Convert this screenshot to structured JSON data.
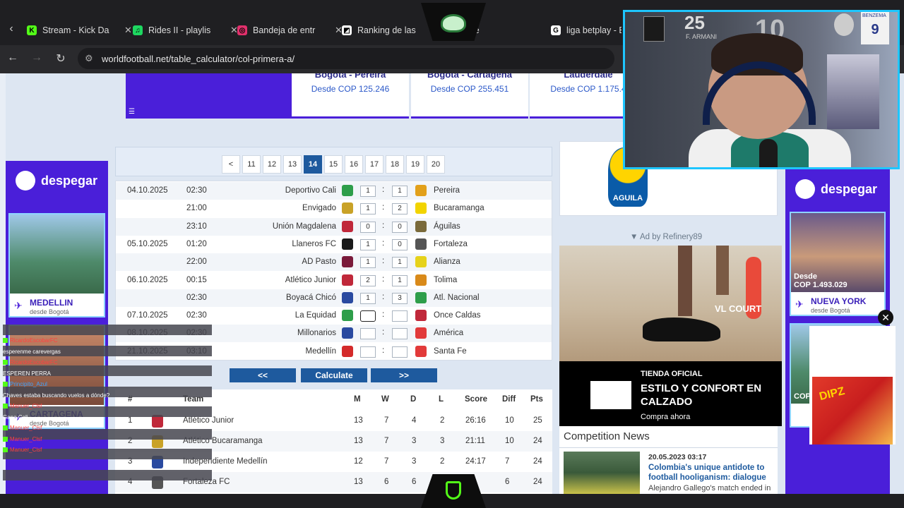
{
  "tabs": [
    {
      "label": "Stream - Kick Da",
      "favicon": "K",
      "favicon_color": "#53fc18"
    },
    {
      "label": "Rides II - playlis",
      "favicon": "♫",
      "favicon_color": "#1ed760"
    },
    {
      "label": "Bandeja de entr",
      "favicon": "◎",
      "favicon_color": "#e1306c"
    },
    {
      "label": "Ranking de las",
      "favicon": "◩",
      "favicon_color": "#ffffff"
    },
    {
      "label": "gle",
      "favicon": "",
      "favicon_color": "#1f1f22"
    },
    {
      "label": "liga betplay - B",
      "favicon": "G",
      "favicon_color": "#ffffff"
    }
  ],
  "url": "worldfootball.net/table_calculator/col-primera-a/",
  "flights": [
    {
      "route": "Bogotá - Pereira",
      "price": "Desde COP 125.246"
    },
    {
      "route": "Bogotá - Cartagena",
      "price": "Desde COP 255.451"
    },
    {
      "route": "Lauderdale",
      "price": "Desde COP 1.175.4"
    }
  ],
  "pagination": {
    "prev": "<",
    "pages": [
      "11",
      "12",
      "13",
      "14",
      "15",
      "16",
      "17",
      "18",
      "19",
      "20"
    ],
    "active": "14"
  },
  "fixtures": [
    {
      "date": "04.10.2025",
      "time": "02:30",
      "home": "Deportivo Cali",
      "home_goals": "1",
      "away_goals": "1",
      "away": "Pereira",
      "home_color": "#2e9e4a",
      "away_color": "#e2a01a"
    },
    {
      "date": "",
      "time": "21:00",
      "home": "Envigado",
      "home_goals": "1",
      "away_goals": "2",
      "away": "Bucaramanga",
      "home_color": "#c9a227",
      "away_color": "#f2d400"
    },
    {
      "date": "",
      "time": "23:10",
      "home": "Unión Magdalena",
      "home_goals": "0",
      "away_goals": "0",
      "away": "Águilas",
      "home_color": "#c0283a",
      "away_color": "#7a6a3a"
    },
    {
      "date": "05.10.2025",
      "time": "01:20",
      "home": "Llaneros FC",
      "home_goals": "1",
      "away_goals": "0",
      "away": "Fortaleza",
      "home_color": "#1a1a1a",
      "away_color": "#555555"
    },
    {
      "date": "",
      "time": "22:00",
      "home": "AD Pasto",
      "home_goals": "1",
      "away_goals": "1",
      "away": "Alianza",
      "home_color": "#7a1a3a",
      "away_color": "#e6d21a"
    },
    {
      "date": "06.10.2025",
      "time": "00:15",
      "home": "Atlético Junior",
      "home_goals": "2",
      "away_goals": "1",
      "away": "Tolima",
      "home_color": "#c0283a",
      "away_color": "#d98a1a"
    },
    {
      "date": "",
      "time": "02:30",
      "home": "Boyacá Chicó",
      "home_goals": "1",
      "away_goals": "3",
      "away": "Atl. Nacional",
      "home_color": "#2a4aa0",
      "away_color": "#2e9e4a"
    },
    {
      "date": "07.10.2025",
      "time": "02:30",
      "home": "La Equidad",
      "home_goals": "",
      "away_goals": "",
      "away": "Once Caldas",
      "home_color": "#2e9e4a",
      "away_color": "#c0283a"
    },
    {
      "date": "08.10.2025",
      "time": "02:30",
      "home": "Millonarios",
      "home_goals": "",
      "away_goals": "",
      "away": "América",
      "home_color": "#2a4aa0",
      "away_color": "#e23a3a"
    },
    {
      "date": "21.10.2025",
      "time": "03:10",
      "home": "Medellín",
      "home_goals": "",
      "away_goals": "",
      "away": "Santa Fe",
      "home_color": "#d42a2a",
      "away_color": "#e23a3a"
    }
  ],
  "calc_buttons": {
    "back": "<<",
    "calculate": "Calculate",
    "forward": ">>"
  },
  "standings": {
    "headers": {
      "pos": "#",
      "team": "Team",
      "m": "M",
      "w": "W",
      "d": "D",
      "l": "L",
      "score": "Score",
      "diff": "Diff",
      "pts": "Pts"
    },
    "rows": [
      {
        "pos": "1",
        "team": "Atlético Junior",
        "m": "13",
        "w": "7",
        "d": "4",
        "l": "2",
        "score": "26:16",
        "diff": "10",
        "pts": "25",
        "color": "#c0283a"
      },
      {
        "pos": "2",
        "team": "Atlético Bucaramanga",
        "m": "13",
        "w": "7",
        "d": "3",
        "l": "3",
        "score": "21:11",
        "diff": "10",
        "pts": "24",
        "color": "#c9a227"
      },
      {
        "pos": "3",
        "team": "Independiente Medellín",
        "m": "12",
        "w": "7",
        "d": "3",
        "l": "2",
        "score": "24:17",
        "diff": "7",
        "pts": "24",
        "color": "#2a4aa0"
      },
      {
        "pos": "4",
        "team": "Fortaleza FC",
        "m": "13",
        "w": "6",
        "d": "6",
        "l": "",
        "score": "",
        "diff": "6",
        "pts": "24",
        "color": "#555555"
      }
    ]
  },
  "side_ads": {
    "brand": "despegar",
    "left": {
      "destination": "MEDELLIN",
      "from": "desde Bogotá",
      "second_destination": "CARTAGENA",
      "second_from": "desde Bogotá"
    },
    "right": {
      "destination": "NUEVA YORK",
      "from": "desde Bogotá",
      "price_label": "Desde",
      "price": "COP 1.493.029",
      "second_price_label": "COP"
    }
  },
  "cup": {
    "label": "AGUILA"
  },
  "ad_note": "▼ Ad by Refinery89",
  "adidas_ad": {
    "slogan": "VL COURT",
    "store": "TIENDA OFICIAL",
    "headline": "ESTILO Y CONFORT EN CALZADO",
    "cta": "Compra ahora"
  },
  "news": {
    "title": "Competition News",
    "date": "20.05.2023 03:17",
    "headline": "Colombia's unique antidote to football hooliganism: dialogue",
    "teaser": "Alejandro Gallego's match ended in"
  },
  "chat": [
    {
      "user": "RicardoEscobarFC",
      "msg": "",
      "red": true
    },
    {
      "user": "",
      "msg": "esperenme carevergas",
      "red": false
    },
    {
      "user": "RicardoEscobarFC",
      "msg": "",
      "red": true
    },
    {
      "user": "",
      "msg": "ESPEREN PERRA",
      "red": false
    },
    {
      "user": "Principito_Azul",
      "msg": "",
      "red": false
    },
    {
      "user": "",
      "msg": "Chaves estaba buscando vuelos a dónde?",
      "red": false
    },
    {
      "user": "Manuer_Clsf",
      "msg": "",
      "red": true
    },
    {
      "user": "",
      "msg": "Gana Cali",
      "red": false
    },
    {
      "user": "Manuer_Clsf",
      "msg": "",
      "red": true
    },
    {
      "user": "Manuer_Clsf",
      "msg": "",
      "red": true
    },
    {
      "user": "Manuer_Clsf",
      "msg": "",
      "red": true
    }
  ],
  "cam": {
    "number_left": "25",
    "name_left": "F. ARMANI",
    "number_mid": "10",
    "number_right": "9",
    "name_right": "BENZEMA"
  },
  "popup": {
    "brand": "DIPZ",
    "close": "✕"
  }
}
